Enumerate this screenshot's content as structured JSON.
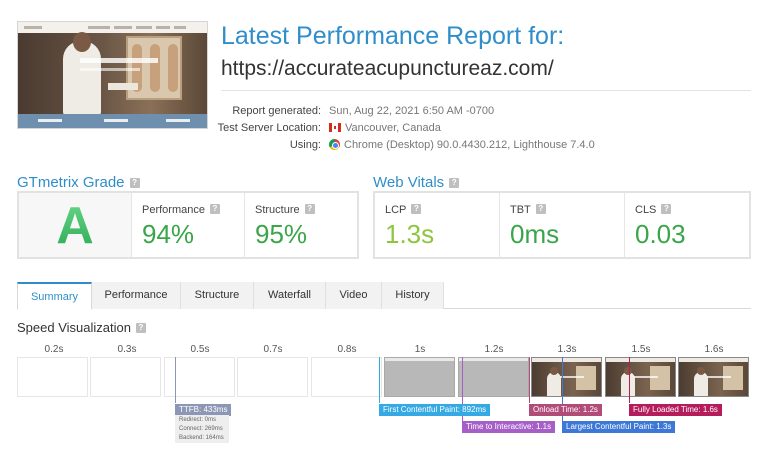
{
  "header": {
    "title": "Latest Performance Report for:",
    "url": "https://accurateacupunctureaz.com/",
    "meta": [
      {
        "label": "Report generated:",
        "value": "Sun, Aug 22, 2021 6:50 AM -0700",
        "icon": ""
      },
      {
        "label": "Test Server Location:",
        "value": "Vancouver, Canada",
        "icon": "canada-flag-icon"
      },
      {
        "label": "Using:",
        "value": "Chrome (Desktop) 90.0.4430.212, Lighthouse 7.4.0",
        "icon": "chrome-icon"
      }
    ]
  },
  "grade": {
    "heading": "GTmetrix Grade",
    "letter": "A",
    "performance_label": "Performance",
    "performance_value": "94%",
    "structure_label": "Structure",
    "structure_value": "95%"
  },
  "vitals": {
    "heading": "Web Vitals",
    "lcp_label": "LCP",
    "lcp_value": "1.3s",
    "tbt_label": "TBT",
    "tbt_value": "0ms",
    "cls_label": "CLS",
    "cls_value": "0.03"
  },
  "tabs": [
    "Summary",
    "Performance",
    "Structure",
    "Waterfall",
    "Video",
    "History"
  ],
  "active_tab": "Summary",
  "speed": {
    "heading": "Speed Visualization",
    "ticks": [
      "0.2s",
      "0.3s",
      "0.5s",
      "0.7s",
      "0.8s",
      "1s",
      "1.2s",
      "1.3s",
      "1.5s",
      "1.6s"
    ],
    "frames": [
      "blank",
      "blank",
      "blank",
      "blank",
      "blank",
      "gray",
      "gray",
      "screenshot",
      "screenshot",
      "screenshot"
    ],
    "ttfb": {
      "label": "TTFB: 433ms",
      "redirect": "Redirect: 0ms",
      "connect": "Connect: 269ms",
      "backend": "Backend: 164ms"
    },
    "markers": {
      "fcp": "First Contentful Paint: 892ms",
      "tti": "Time to Interactive: 1.1s",
      "onload": "Onload Time: 1.2s",
      "lcp": "Largest Contentful Paint: 1.3s",
      "fully": "Fully Loaded Time: 1.6s"
    }
  },
  "colors": {
    "accent": "#2f8ec9",
    "grade": "#3aa54a",
    "lcp": "#8cc63f",
    "ttfb": "#8c97b6",
    "fcp": "#35a9e4",
    "tti": "#a55fc7",
    "onload": "#b14b78",
    "lcp_marker": "#3e78d6",
    "fully": "#b51c5c"
  }
}
